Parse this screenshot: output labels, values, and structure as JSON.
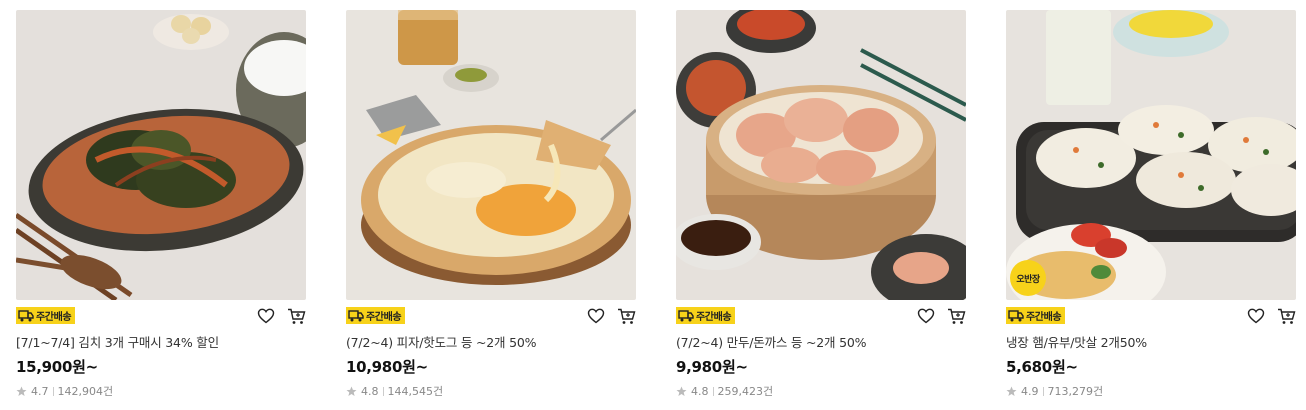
{
  "products": [
    {
      "title": "[7/1~7/4] 김치 3개 구매시 34% 할인",
      "price": "15,900원~",
      "rating": "4.7",
      "reviews": "142,904건",
      "delivery_badge": "주간배송",
      "circle_badge": ""
    },
    {
      "title": "(7/2~4) 피자/핫도그 등 ~2개 50%",
      "price": "10,980원~",
      "rating": "4.8",
      "reviews": "144,545건",
      "delivery_badge": "주간배송",
      "circle_badge": ""
    },
    {
      "title": "(7/2~4) 만두/돈까스 등 ~2개 50%",
      "price": "9,980원~",
      "rating": "4.8",
      "reviews": "259,423건",
      "delivery_badge": "주간배송",
      "circle_badge": ""
    },
    {
      "title": "냉장 햄/유부/맛살 2개50%",
      "price": "5,680원~",
      "rating": "4.9",
      "reviews": "713,279건",
      "delivery_badge": "주간배송",
      "circle_badge": "오반장"
    }
  ],
  "colors": {
    "badge_yellow": "#f7d21a",
    "star_gray": "#bbbbbb",
    "text_dark": "#111111"
  },
  "icons": [
    "truck-icon",
    "heart-icon",
    "cart-icon",
    "star-icon"
  ]
}
